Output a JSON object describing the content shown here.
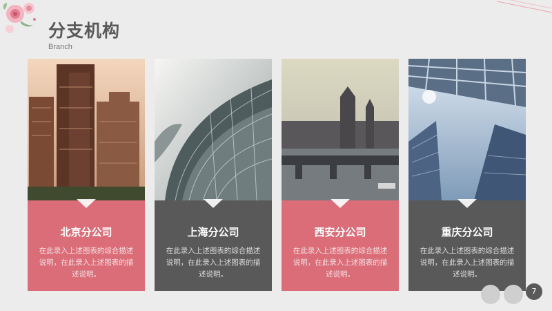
{
  "header": {
    "title": "分支机构",
    "subtitle": "Branch"
  },
  "cards": [
    {
      "name": "北京分公司",
      "desc": "在此录入上述图表的综合描述说明，在此录入上述图表的描述说明。"
    },
    {
      "name": "上海分公司",
      "desc": "在此录入上述图表的综合描述说明，在此录入上述图表的描述说明。"
    },
    {
      "name": "西安分公司",
      "desc": "在此录入上述图表的综合描述说明，在此录入上述图表的描述说明。"
    },
    {
      "name": "重庆分公司",
      "desc": "在此录入上述图表的综合描述说明，在此录入上述图表的描述说明。"
    }
  ],
  "footer": {
    "page_number": "7"
  },
  "colors": {
    "pink": "#db6d78",
    "gray": "#595959",
    "background": "#ececec"
  }
}
